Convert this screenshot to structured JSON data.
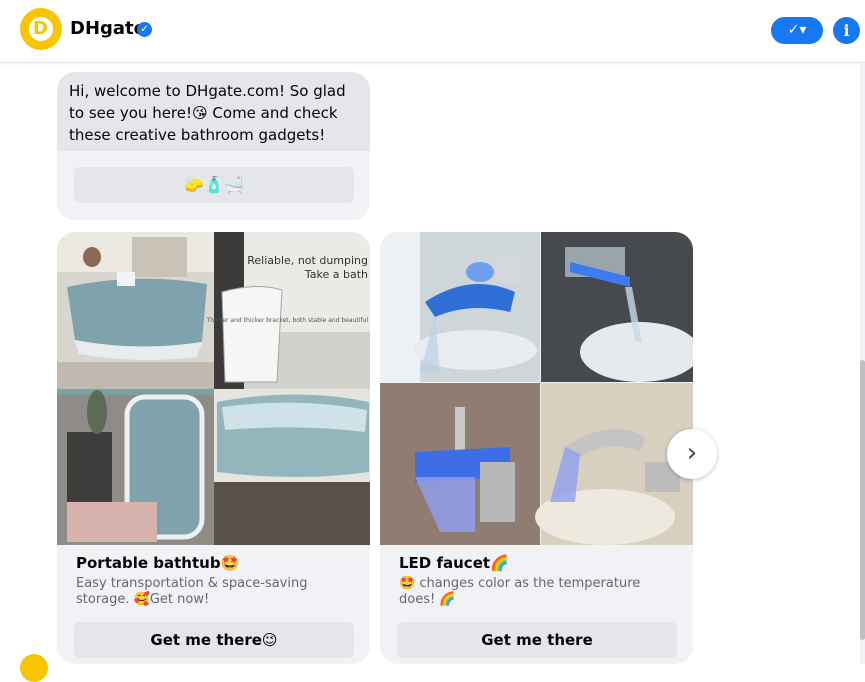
{
  "header": {
    "name": "DHgate",
    "logo_letter": "D",
    "verified_glyph": "✓",
    "check_glyph": "✓▾",
    "info_glyph": "i",
    "colors": {
      "accent": "#1877f2",
      "brand": "#f7c600"
    }
  },
  "welcome": {
    "text": "Hi, welcome to DHgate.com! So glad  to see you here!😘 Come and check these creative bathroom  gadgets!",
    "quick_reply": "🧽🧴🛁"
  },
  "cards": [
    {
      "title": "Portable bathtub🤩",
      "subtitle": "Easy  transportation &  space-saving storage. 🥰Get now!",
      "button": "Get me there😉",
      "image_caption_1": "Reliable, not dumping",
      "image_caption_2": "Take a bath",
      "image_caption_3": "Thicker and thicker bracket, both stable and beautiful"
    },
    {
      "title": "LED faucet🌈",
      "subtitle": "🤩 changes color as the temperature does! 🌈",
      "button": "Get me there"
    }
  ],
  "carousel": {
    "next_glyph": "›"
  }
}
